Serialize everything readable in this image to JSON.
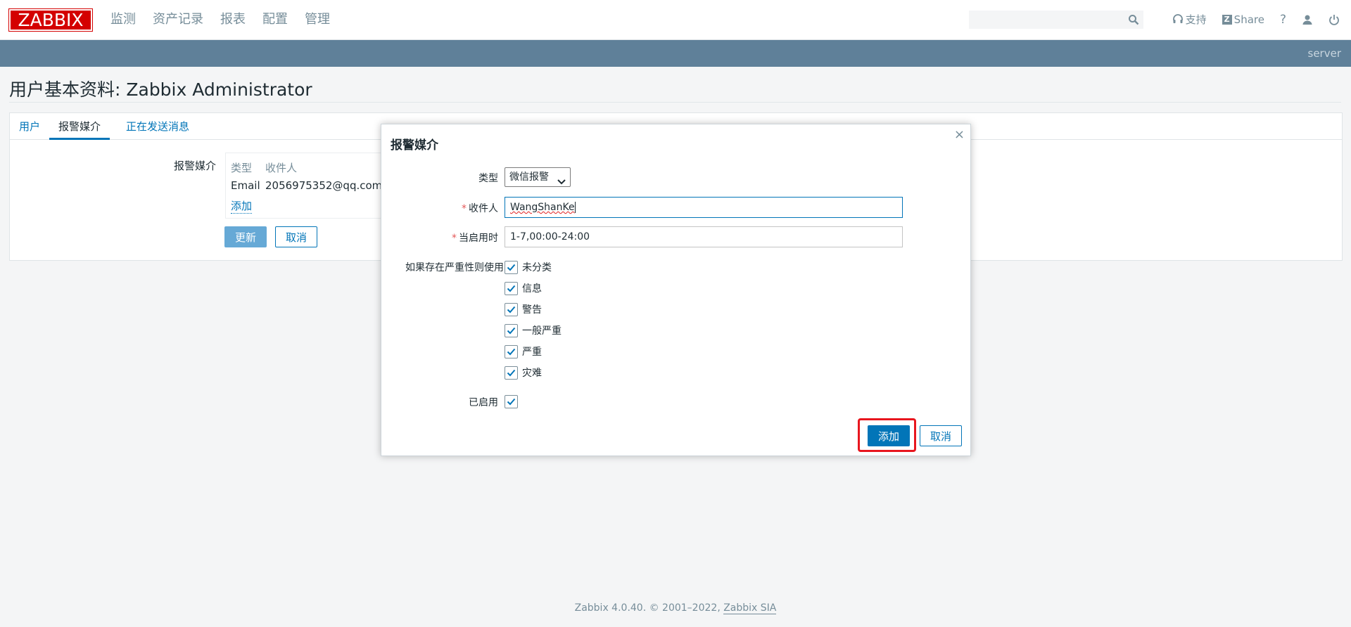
{
  "header": {
    "logo_text": "ZABBIX",
    "menu": [
      "监测",
      "资产记录",
      "报表",
      "配置",
      "管理"
    ],
    "search_placeholder": "",
    "support_label": "支持",
    "share_label": "Share",
    "help_label": "?"
  },
  "server_band": {
    "server_name": "server"
  },
  "page": {
    "title": "用户基本资料: Zabbix Administrator"
  },
  "tabs": [
    {
      "label": "用户"
    },
    {
      "label": "报警媒介"
    },
    {
      "label": "正在发送消息"
    }
  ],
  "media": {
    "field_label": "报警媒介",
    "columns": [
      "类型",
      "收件人"
    ],
    "rows": [
      {
        "type": "Email",
        "recipient": "2056975352@qq.com"
      }
    ],
    "add_link": "添加",
    "update_button": "更新",
    "cancel_button": "取消"
  },
  "dialog": {
    "title": "报警媒介",
    "close_glyph": "×",
    "type_label": "类型",
    "type_value": "微信报警",
    "recipient_label": "收件人",
    "recipient_value": "WangShanKe",
    "when_active_label": "当启用时",
    "when_active_value": "1-7,00:00-24:00",
    "severity_label": "如果存在严重性则使用",
    "severities": [
      {
        "label": "未分类",
        "checked": true
      },
      {
        "label": "信息",
        "checked": true
      },
      {
        "label": "警告",
        "checked": true
      },
      {
        "label": "一般严重",
        "checked": true
      },
      {
        "label": "严重",
        "checked": true
      },
      {
        "label": "灾难",
        "checked": true
      }
    ],
    "enabled_label": "已启用",
    "enabled_checked": true,
    "add_button": "添加",
    "cancel_button": "取消"
  },
  "footer": {
    "text": "Zabbix 4.0.40. © 2001–2022, ",
    "link": "Zabbix SIA"
  },
  "colors": {
    "brand_red": "#d40000",
    "accent_blue": "#0275b8",
    "server_band": "#5f8099",
    "highlight_red": "#e8161e"
  }
}
